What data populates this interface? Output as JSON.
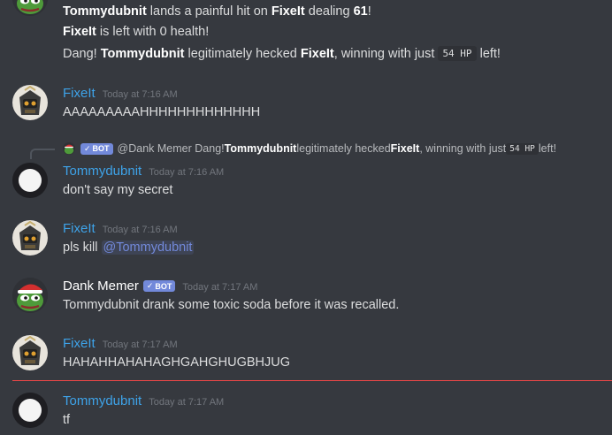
{
  "messages": {
    "dank_cont": {
      "line1": {
        "pre": "Tommydubnit",
        "mid": " lands a painful hit on ",
        "target": "FixeIt",
        "mid2": " dealing ",
        "dmg": "61",
        "post": "!"
      },
      "line2": {
        "target": "FixeIt",
        "post": " is left with 0 health!"
      },
      "line3": {
        "pre": "Dang! ",
        "winner": "Tommydubnit",
        "mid": " legitimately hecked ",
        "target": "FixeIt",
        "mid2": ", winning with just ",
        "hp": "54 HP",
        "post": " left!"
      }
    },
    "m1": {
      "author": "FixeIt",
      "time": "Today at 7:16 AM",
      "text": "AAAAAAAAAHHHHHHHHHHHHH"
    },
    "reply": {
      "bot_tag": "BOT",
      "author": "@Dank Memer",
      "pre": "Dang! ",
      "winner": "Tommydubnit",
      "mid": " legitimately hecked ",
      "target": "FixeIt",
      "mid2": ", winning with just ",
      "hp": "54 HP",
      "post": " left!"
    },
    "m2": {
      "author": "Tommydubnit",
      "time": "Today at 7:16 AM",
      "text": "don't say my secret"
    },
    "m3": {
      "author": "FixeIt",
      "time": "Today at 7:16 AM",
      "pre": "pls kill ",
      "mention": "@Tommydubnit"
    },
    "m4": {
      "author": "Dank Memer",
      "bot_tag": "BOT",
      "time": "Today at 7:17 AM",
      "text": "Tommydubnit drank some toxic soda before it was recalled."
    },
    "m5": {
      "author": "FixeIt",
      "time": "Today at 7:17 AM",
      "text": "HAHAHHAHAHAGHGAHGHUGBHJUG"
    },
    "m6": {
      "author": "Tommydubnit",
      "time": "Today at 7:17 AM",
      "text": "tf"
    }
  },
  "colors": {
    "background": "#36393f",
    "username_blue": "#3ea3e9",
    "bot_tag": "#7289da",
    "timestamp": "#72767d",
    "new_messages_divider": "#f04747"
  },
  "icons": {
    "dank_avatar": "pepe-santa-avatar",
    "fixelt_avatar": "robot-avatar",
    "tommy_avatar": "white-circle-avatar",
    "bot_check": "check-icon"
  }
}
